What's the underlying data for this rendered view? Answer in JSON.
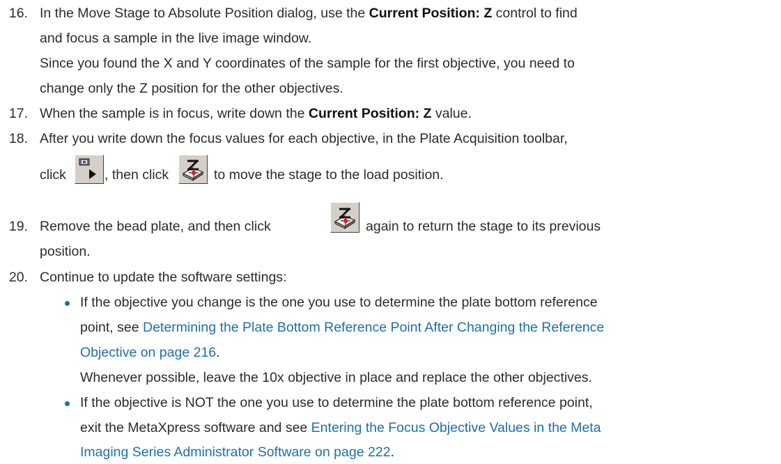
{
  "steps": [
    {
      "number": "16.",
      "text_a": "In the Move Stage to Absolute Position dialog, use the ",
      "bold": "Current Position: Z",
      "text_b": " control to find",
      "line2": "and focus a sample in the live image window.",
      "note1": "Since you found the X and Y coordinates of the sample for the first objective, you need to",
      "note2": "change only the Z position for the other objectives."
    },
    {
      "number": "17.",
      "text_a": "When the sample is in focus, write down the ",
      "bold": "Current Position: Z",
      "text_b": " value."
    },
    {
      "number": "18.",
      "line1": "After you write down the focus values for each objective, in the Plate Acquisition toolbar,",
      "click": "click",
      "then_click": ", then click",
      "tail": "to move the stage to the load position.",
      "icons": [
        "play-acquisition-icon",
        "load-position-icon"
      ]
    },
    {
      "number": "19.",
      "text_a": "Remove the bead plate, and then click",
      "text_b": "again to return the stage to its previous",
      "line2": "position.",
      "icons": [
        "load-position-icon"
      ]
    },
    {
      "number": "20.",
      "line1": "Continue to update the software settings:",
      "bullets": [
        {
          "line1": "If the objective you change is the one you use to determine the plate bottom reference",
          "line2_text": "point, see ",
          "link_line2": "Determining the Plate Bottom Reference Point After Changing the Reference",
          "link_line3": "Objective on page 216",
          "line3_tail": ".",
          "note": "Whenever possible, leave the 10x objective in place and replace the other objectives."
        },
        {
          "line1": "If the objective is NOT the one you use to determine the plate bottom reference point,",
          "line2_text": "exit the MetaXpress software and see ",
          "link_line2": "Entering the Focus Objective Values in the Meta",
          "link_line3": "Imaging Series Administrator Software on page 222",
          "line3_tail": "."
        }
      ]
    }
  ],
  "colors": {
    "link": "#1f6fa8",
    "text": "#2b2b2b",
    "button_face": "#d4d0c8"
  }
}
